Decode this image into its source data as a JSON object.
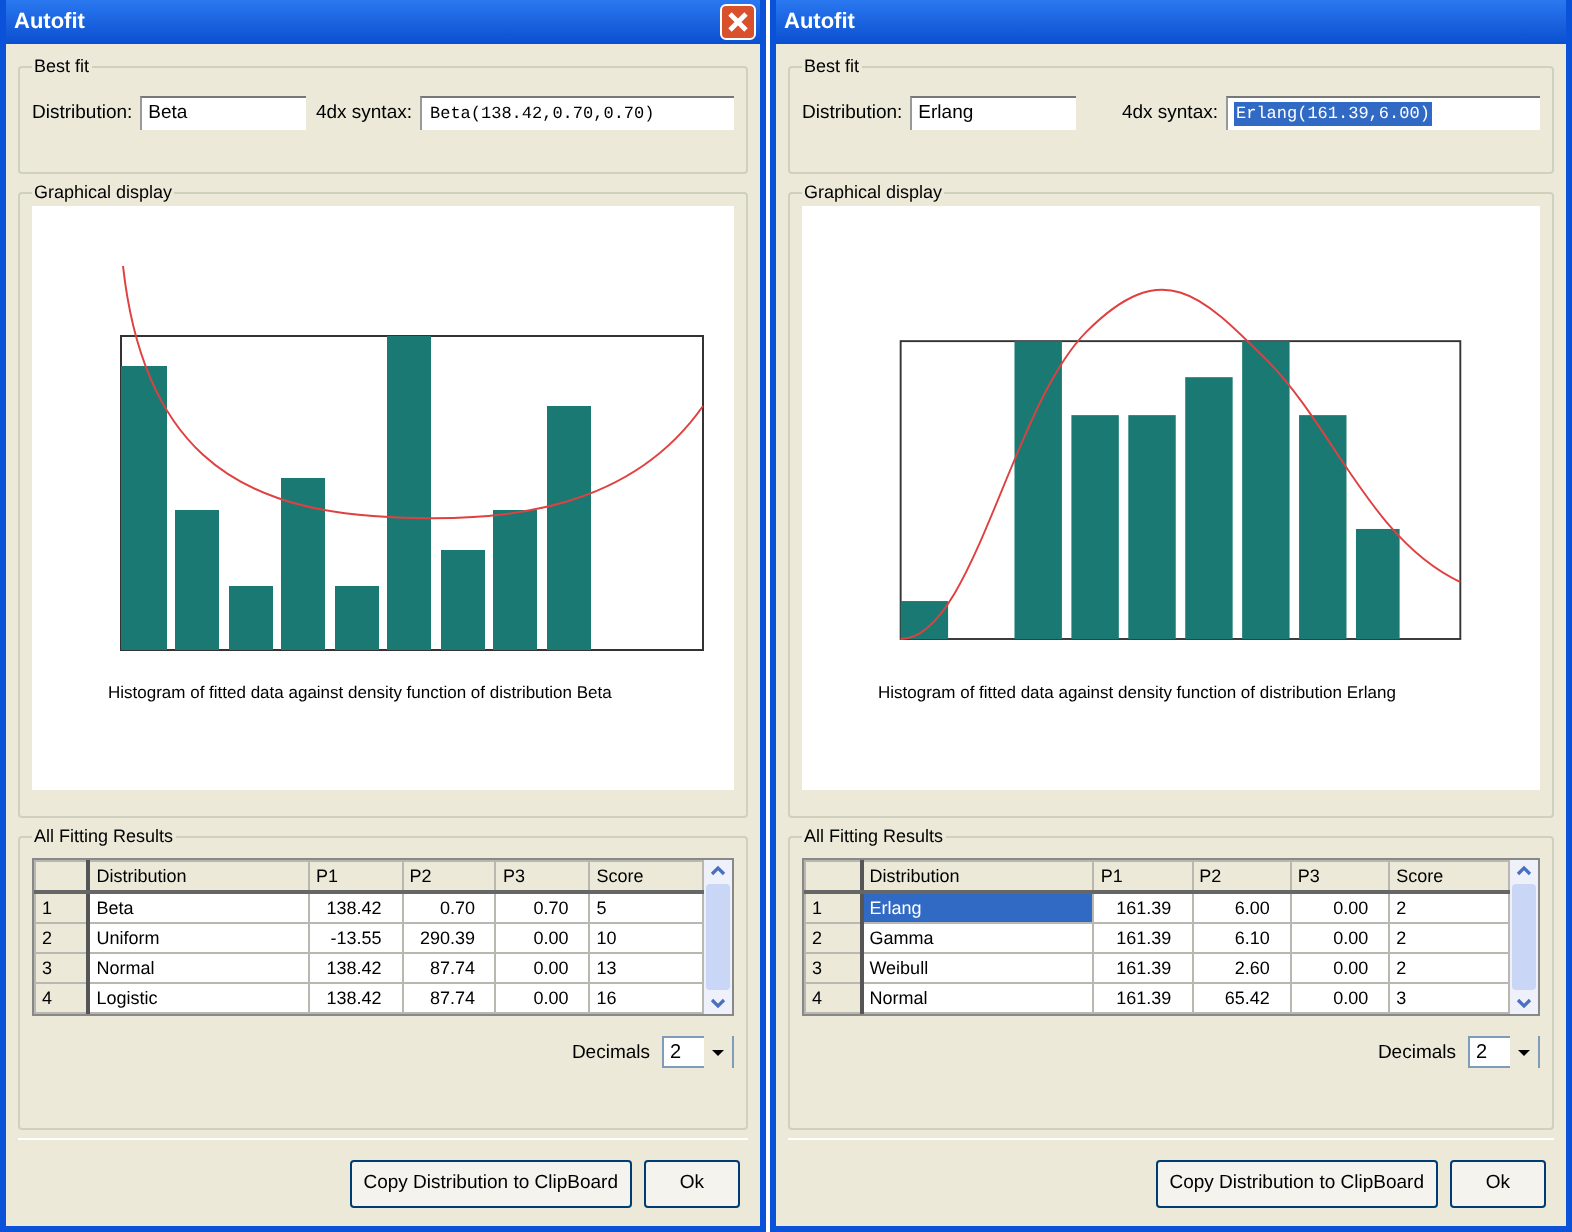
{
  "windows": [
    {
      "title": "Autofit",
      "close_button": true,
      "best_fit": {
        "label": "Best fit",
        "distribution_label": "Distribution:",
        "distribution": "Beta",
        "syntax_label": "4dx syntax:",
        "syntax": "Beta(138.42,0.70,0.70)",
        "syntax_selected": false
      },
      "graphical_display": {
        "label": "Graphical display",
        "caption": "Histogram of fitted data against density function of distribution Beta"
      },
      "results": {
        "label": "All Fitting Results",
        "columns": [
          "Distribution",
          "P1",
          "P2",
          "P3",
          "Score"
        ],
        "rows": [
          {
            "number": "1",
            "cells": [
              "Beta",
              "138.42",
              "0.70",
              "0.70",
              "5"
            ],
            "selected": false
          },
          {
            "number": "2",
            "cells": [
              "Uniform",
              "-13.55",
              "290.39",
              "0.00",
              "10"
            ],
            "selected": false
          },
          {
            "number": "3",
            "cells": [
              "Normal",
              "138.42",
              "87.74",
              "0.00",
              "13"
            ],
            "selected": false
          },
          {
            "number": "4",
            "cells": [
              "Logistic",
              "138.42",
              "87.74",
              "0.00",
              "16"
            ],
            "selected": false
          }
        ]
      },
      "decimals": {
        "label": "Decimals",
        "value": "2"
      },
      "buttons": [
        "Copy Distribution to ClipBoard",
        "Ok"
      ]
    },
    {
      "title": "Autofit",
      "close_button": false,
      "best_fit": {
        "label": "Best fit",
        "distribution_label": "Distribution:",
        "distribution": "Erlang",
        "syntax_label": "4dx syntax:",
        "syntax": "Erlang(161.39,6.00)",
        "syntax_selected": true
      },
      "graphical_display": {
        "label": "Graphical display",
        "caption": "Histogram of fitted data against density function of distribution Erlang"
      },
      "results": {
        "label": "All Fitting Results",
        "columns": [
          "Distribution",
          "P1",
          "P2",
          "P3",
          "Score"
        ],
        "rows": [
          {
            "number": "1",
            "cells": [
              "Erlang",
              "161.39",
              "6.00",
              "0.00",
              "2"
            ],
            "selected": true
          },
          {
            "number": "2",
            "cells": [
              "Gamma",
              "161.39",
              "6.10",
              "0.00",
              "2"
            ],
            "selected": false
          },
          {
            "number": "3",
            "cells": [
              "Weibull",
              "161.39",
              "2.60",
              "0.00",
              "2"
            ],
            "selected": false
          },
          {
            "number": "4",
            "cells": [
              "Normal",
              "161.39",
              "65.42",
              "0.00",
              "3"
            ],
            "selected": false
          }
        ]
      },
      "decimals": {
        "label": "Decimals",
        "value": "2"
      },
      "buttons": [
        "Copy Distribution to ClipBoard",
        "Ok"
      ]
    }
  ]
}
